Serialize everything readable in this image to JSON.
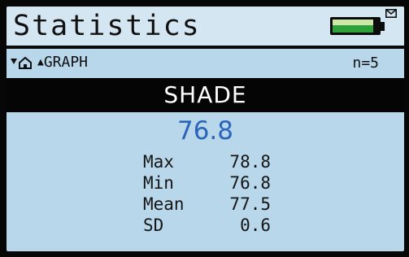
{
  "title": "Statistics",
  "nav": {
    "graph_label": "GRAPH",
    "count": "n=5"
  },
  "header": {
    "label": "SHADE"
  },
  "current_value": "76.8",
  "stats": [
    {
      "label": "Max",
      "value": "78.8"
    },
    {
      "label": "Min",
      "value": "76.8"
    },
    {
      "label": "Mean",
      "value": "77.5"
    },
    {
      "label": "SD",
      "value": "0.6"
    }
  ],
  "battery": {
    "level": 0.9
  },
  "icons": {
    "home": "home-icon",
    "down_arrow": "down-arrow-icon",
    "up_arrow": "up-arrow-icon",
    "battery": "battery-icon",
    "mail": "mail-icon"
  },
  "colors": {
    "screen_bg": "#b9d7ea",
    "accent_value": "#2b64b8",
    "battery_green": "#2da23a"
  }
}
